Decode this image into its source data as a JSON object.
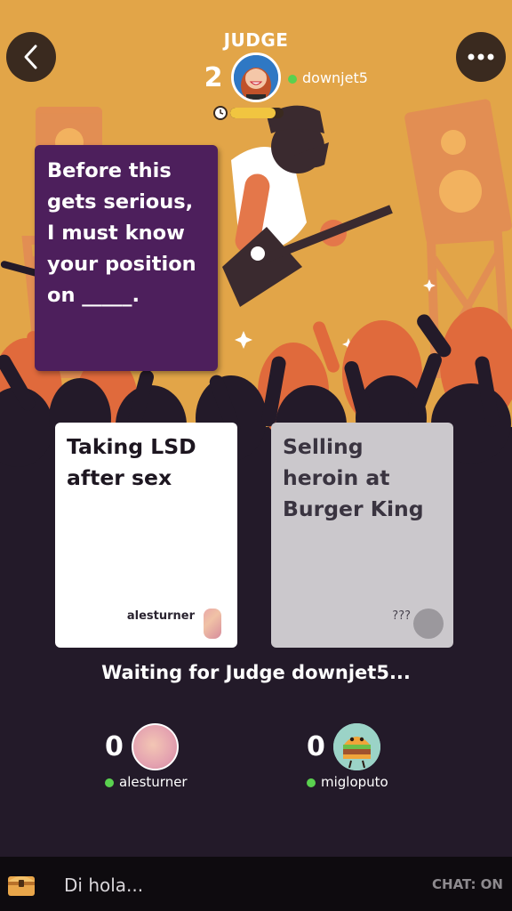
{
  "header": {
    "role_label": "JUDGE",
    "judge_score": "2",
    "judge_name": "downjet5",
    "timer_remaining": 0.85
  },
  "black_card": {
    "text": "Before this gets serious, I must know your position on _____."
  },
  "answer_cards": [
    {
      "text": "Taking LSD after sex",
      "author": "alesturner"
    },
    {
      "text": "Selling heroin at Burger King",
      "author": "???"
    }
  ],
  "status": "Waiting for Judge downjet5...",
  "players": [
    {
      "score": "0",
      "name": "alesturner"
    },
    {
      "score": "0",
      "name": "migloputo"
    }
  ],
  "chat": {
    "placeholder": "Di hola...",
    "toggle_label": "CHAT: ON"
  },
  "colors": {
    "stage_bg": "#e2a548",
    "crowd": "#231a29",
    "black_card": "#4d1f5c",
    "online": "#5ad14f",
    "timer": "#f1c540"
  },
  "icons": {
    "back": "chevron-left-icon",
    "menu": "more-horizontal-icon",
    "timer": "clock-icon",
    "chest": "treasure-chest-icon"
  }
}
